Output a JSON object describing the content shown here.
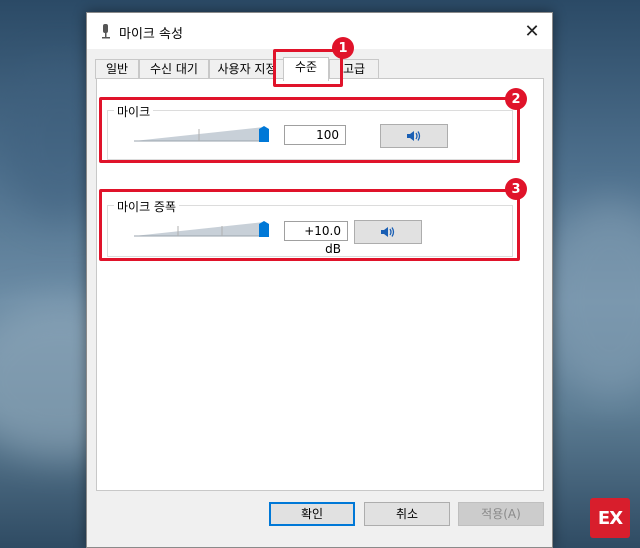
{
  "window": {
    "title": "마이크 속성",
    "close_label": "✕"
  },
  "tabs": [
    {
      "label": "일반"
    },
    {
      "label": "수신 대기"
    },
    {
      "label": "사용자 지정"
    },
    {
      "label": "수준"
    },
    {
      "label": "고급"
    }
  ],
  "active_tab": "수준",
  "groups": {
    "mic": {
      "label": "마이크",
      "value_text": "100",
      "level": 1.0
    },
    "boost": {
      "label": "마이크 증폭",
      "value_text": "+10.0 dB",
      "level": 1.0
    }
  },
  "annotations": [
    "1",
    "2",
    "3"
  ],
  "buttons": {
    "ok": "확인",
    "cancel": "취소",
    "apply": "적용(A)"
  },
  "watermark": "EX",
  "colors": {
    "highlight": "#e0132a",
    "accent": "#0078d7"
  }
}
